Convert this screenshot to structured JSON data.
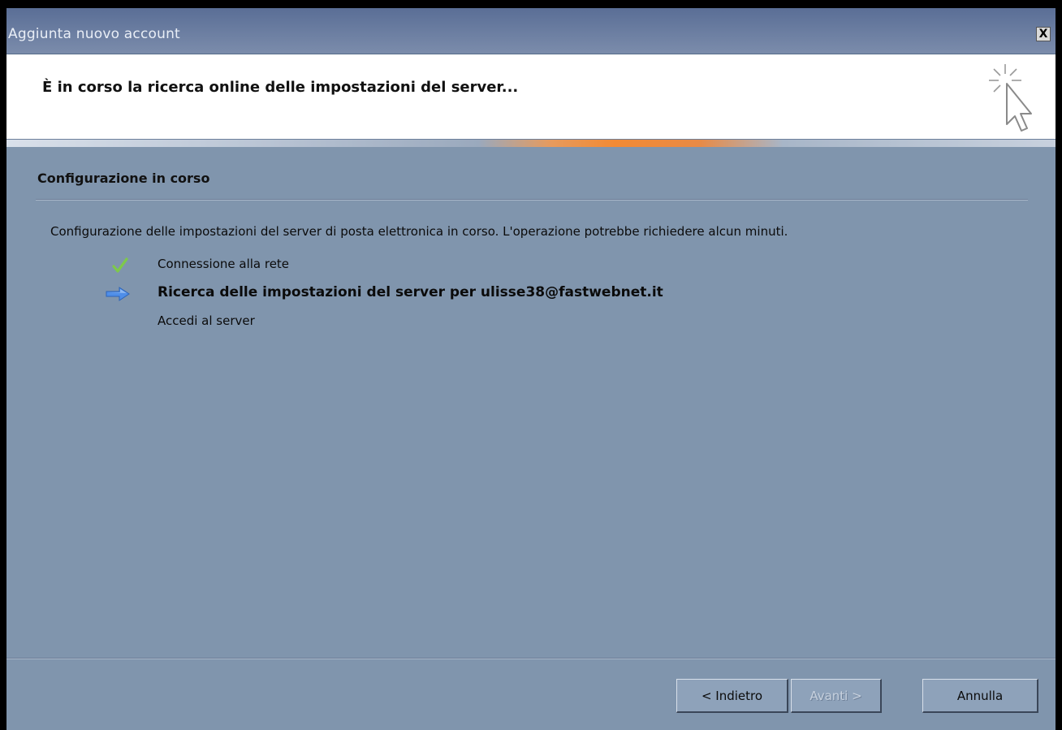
{
  "window": {
    "title": "Aggiunta nuovo account",
    "close_label": "X"
  },
  "header": {
    "title": "È in corso la ricerca online delle impostazioni del server..."
  },
  "section": {
    "title": "Configurazione in corso",
    "description": "Configurazione delle impostazioni del server di posta elettronica in corso. L'operazione potrebbe richiedere alcun minuti."
  },
  "steps": [
    {
      "label": "Connessione alla rete",
      "status": "done",
      "icon": "checkmark-icon"
    },
    {
      "label": "Ricerca delle impostazioni del server per ulisse38@fastwebnet.it",
      "status": "in-progress",
      "icon": "arrow-right-icon"
    },
    {
      "label": "Accedi al server",
      "status": "pending",
      "icon": ""
    }
  ],
  "buttons": {
    "back": "< Indietro",
    "next": "Avanti >",
    "cancel": "Annulla"
  },
  "colors": {
    "dialog_background": "#8095ad",
    "header_background": "#ffffff",
    "accent_stripe": "#f28a34",
    "check_green": "#7ec94a",
    "arrow_blue": "#4f8ee8"
  }
}
